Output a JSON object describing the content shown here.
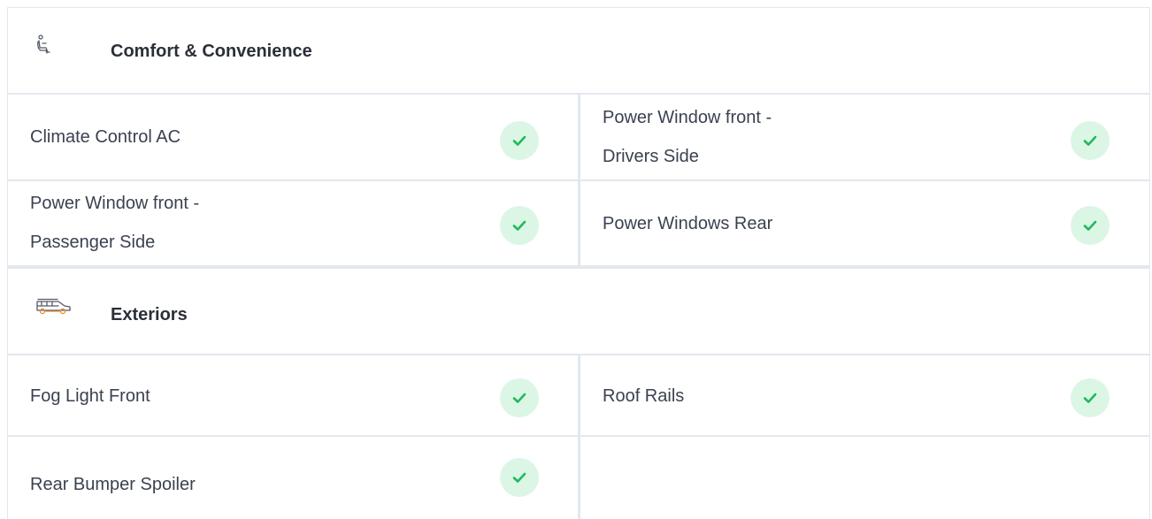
{
  "sections": [
    {
      "title": "Comfort & Convenience",
      "icon": "car-seat-icon",
      "items": [
        {
          "label": "Climate Control AC",
          "available": true
        },
        {
          "label": "Power Window front - Drivers Side",
          "label_line1": "Power Window front -",
          "label_line2": "Drivers Side",
          "available": true
        },
        {
          "label": "Power Window front - Passenger Side",
          "label_line1": "Power Window front -",
          "label_line2": "Passenger Side",
          "available": true
        },
        {
          "label": "Power Windows Rear",
          "available": true
        }
      ]
    },
    {
      "title": "Exteriors",
      "icon": "car-exterior-icon",
      "items": [
        {
          "label": "Fog Light Front",
          "available": true
        },
        {
          "label": "Roof Rails",
          "available": true
        },
        {
          "label": "Rear Bumper Spoiler",
          "available": true
        }
      ]
    }
  ],
  "colors": {
    "check_bg": "#dcf6e6",
    "check_mark": "#1fba5c",
    "border": "#e3e7ee",
    "icon_gray": "#555b66",
    "icon_orange": "#e8892b"
  }
}
